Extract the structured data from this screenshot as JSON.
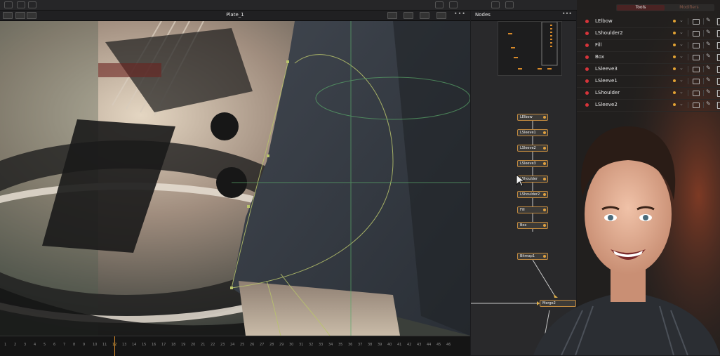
{
  "viewer": {
    "title": "Plate_1",
    "timeline_labels": [
      "1",
      "2",
      "3",
      "4",
      "5",
      "6",
      "7",
      "8",
      "9",
      "10",
      "11",
      "12",
      "13",
      "14",
      "15",
      "16",
      "17",
      "18",
      "19",
      "20",
      "21",
      "22",
      "23",
      "24",
      "25",
      "26",
      "27",
      "28",
      "29",
      "30",
      "31",
      "32",
      "33",
      "34",
      "35",
      "36",
      "37",
      "38",
      "39",
      "40",
      "41",
      "42",
      "43",
      "44",
      "45",
      "46"
    ],
    "current_frame": "12"
  },
  "nodes": {
    "title": "Nodes",
    "items": [
      "LElbow",
      "LSleeve1",
      "LSleeve2",
      "LSleeve3",
      "LShoulder",
      "LShoulder2",
      "Fill",
      "Box",
      "Bitmap1"
    ],
    "merge": "Merge2"
  },
  "inspector": {
    "tabs": [
      "Tools",
      "Modifiers"
    ],
    "tools": [
      "LElbow",
      "LShoulder2",
      "Fill",
      "Box",
      "LSleeve3",
      "LSleeve1",
      "LShoulder",
      "LSleeve2"
    ]
  },
  "colors": {
    "accent": "#e2a233",
    "tool_dot": "#d8343a",
    "active_tab": "#4a2323",
    "node_border": "#c28a3f",
    "playhead": "#d88a2a"
  },
  "icons": [
    "chevron-down-icon",
    "folder-icon",
    "pin-icon",
    "visibility-icon",
    "cursor-icon"
  ]
}
